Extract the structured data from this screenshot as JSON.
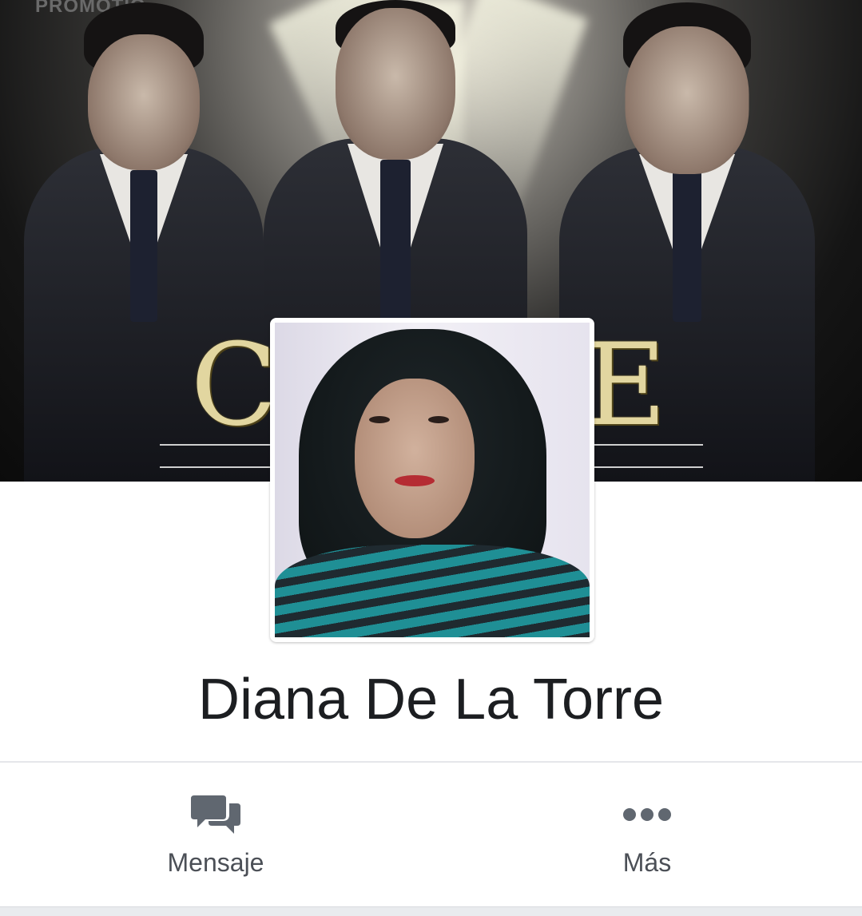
{
  "cover": {
    "band_text": "CO     STE",
    "promo_text": "PROMOTIO"
  },
  "profile": {
    "name": "Diana De La Torre"
  },
  "actions": [
    {
      "label": "Mensaje",
      "icon": "message-bubbles-icon"
    },
    {
      "label": "Más",
      "icon": "more-dots-icon"
    }
  ],
  "colors": {
    "name_text": "#1c1e21",
    "action_text": "#4b4f56",
    "icon_fill": "#606770",
    "divider": "#e5e6ea"
  }
}
